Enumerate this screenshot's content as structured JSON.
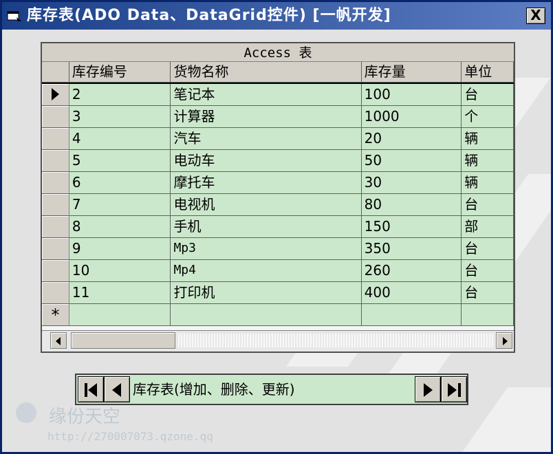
{
  "window": {
    "title": "库存表(ADO Data、DataGrid控件) [一帆开发]",
    "close_label": "X"
  },
  "grid": {
    "caption": "Access 表",
    "columns": [
      "库存编号",
      "货物名称",
      "库存量",
      "单位"
    ],
    "rows": [
      {
        "id": "2",
        "name": "笔记本",
        "qty": "100",
        "unit": "台",
        "current": true
      },
      {
        "id": "3",
        "name": "计算器",
        "qty": "1000",
        "unit": "个"
      },
      {
        "id": "4",
        "name": "汽车",
        "qty": "20",
        "unit": "辆"
      },
      {
        "id": "5",
        "name": "电动车",
        "qty": "50",
        "unit": "辆"
      },
      {
        "id": "6",
        "name": "摩托车",
        "qty": "30",
        "unit": "辆"
      },
      {
        "id": "7",
        "name": "电视机",
        "qty": "80",
        "unit": "台"
      },
      {
        "id": "8",
        "name": "手机",
        "qty": "150",
        "unit": "部"
      },
      {
        "id": "9",
        "name": "Mp3",
        "qty": "350",
        "unit": "台"
      },
      {
        "id": "10",
        "name": "Mp4",
        "qty": "260",
        "unit": "台"
      },
      {
        "id": "11",
        "name": "打印机",
        "qty": "400",
        "unit": "台"
      }
    ],
    "new_row_marker": "*"
  },
  "data_control": {
    "caption": "库存表(增加、删除、更新)"
  },
  "watermark": {
    "text": "缘份天空",
    "url": "http://270007073.qzone.qq"
  },
  "colors": {
    "titlebar": "#1a3f88",
    "cell_bg": "#cce8cc",
    "window_bg": "#e2e2e2"
  }
}
